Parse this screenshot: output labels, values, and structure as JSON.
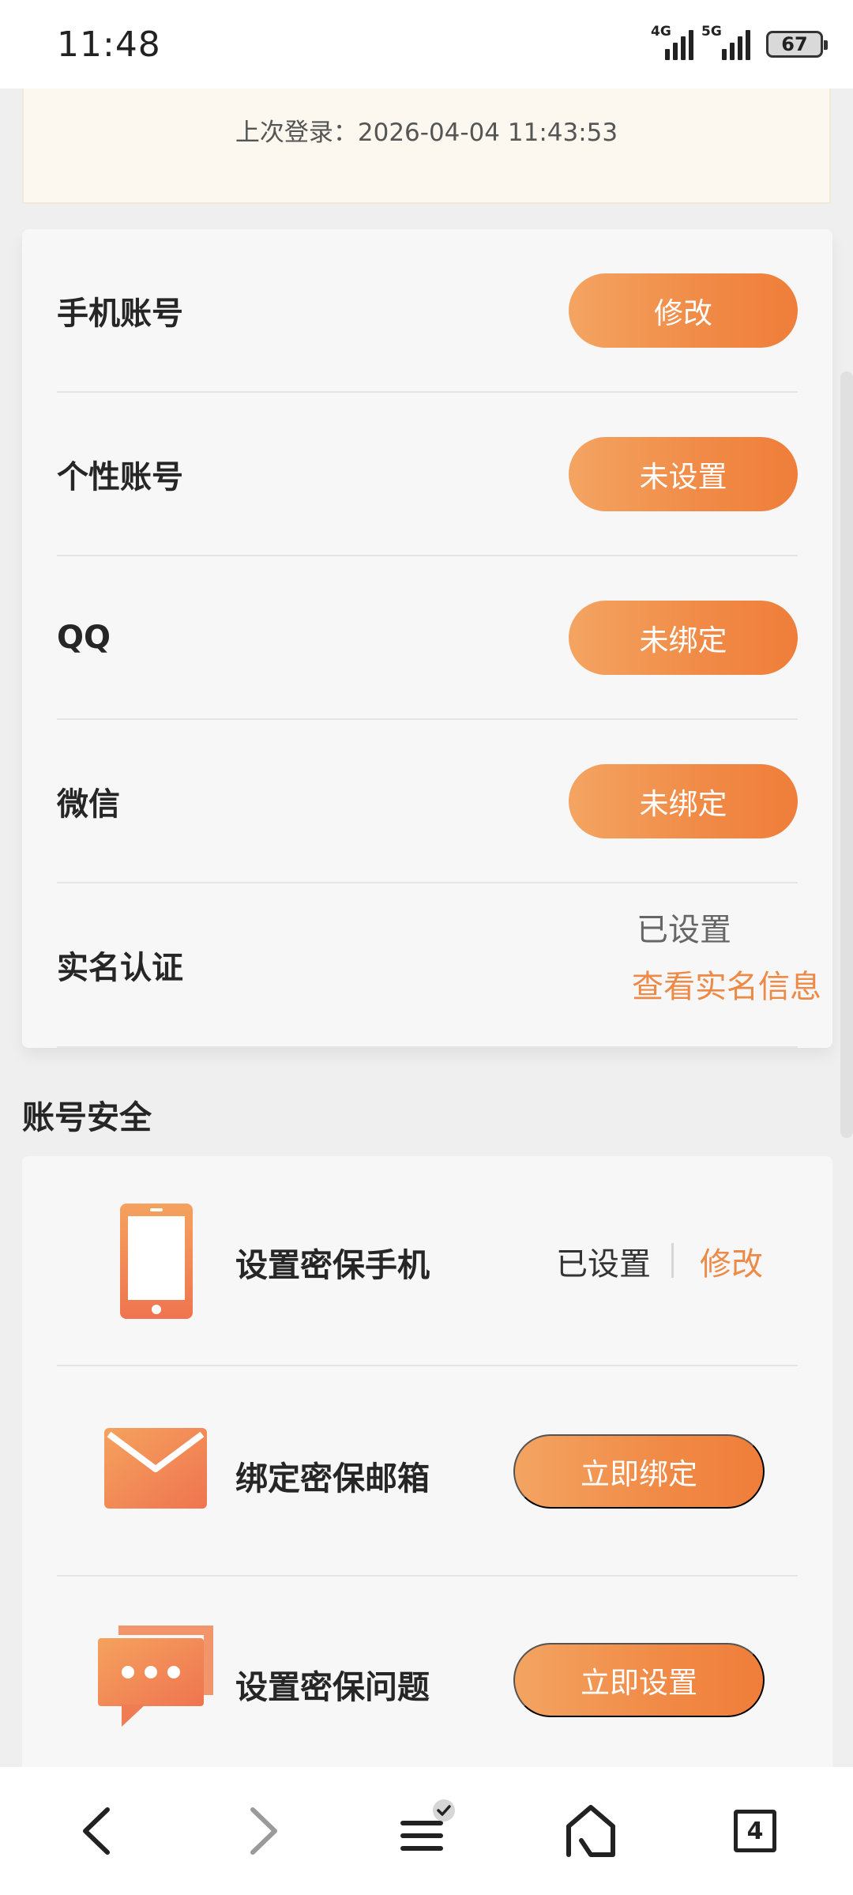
{
  "status_bar": {
    "time": "11:48",
    "network1": "4G",
    "network2": "5G",
    "battery": "67"
  },
  "login": {
    "last_login": "上次登录：2026-04-04 11:43:53"
  },
  "account": {
    "rows": [
      {
        "label": "手机账号",
        "action": "修改"
      },
      {
        "label": "个性账号",
        "action": "未设置"
      },
      {
        "label": "QQ",
        "action": "未绑定"
      },
      {
        "label": "微信",
        "action": "未绑定"
      }
    ],
    "realname": {
      "label": "实名认证",
      "status": "已设置",
      "link": "查看实名信息"
    }
  },
  "security": {
    "title": "账号安全",
    "phone": {
      "label": "设置密保手机",
      "status": "已设置",
      "link": "修改"
    },
    "email": {
      "label": "绑定密保邮箱",
      "action": "立即绑定"
    },
    "question": {
      "label": "设置密保问题",
      "action": "立即设置"
    }
  },
  "nav": {
    "tabs_count": "4"
  },
  "colors": {
    "accent": "#ef8a46",
    "accent_light": "#f4a462"
  }
}
